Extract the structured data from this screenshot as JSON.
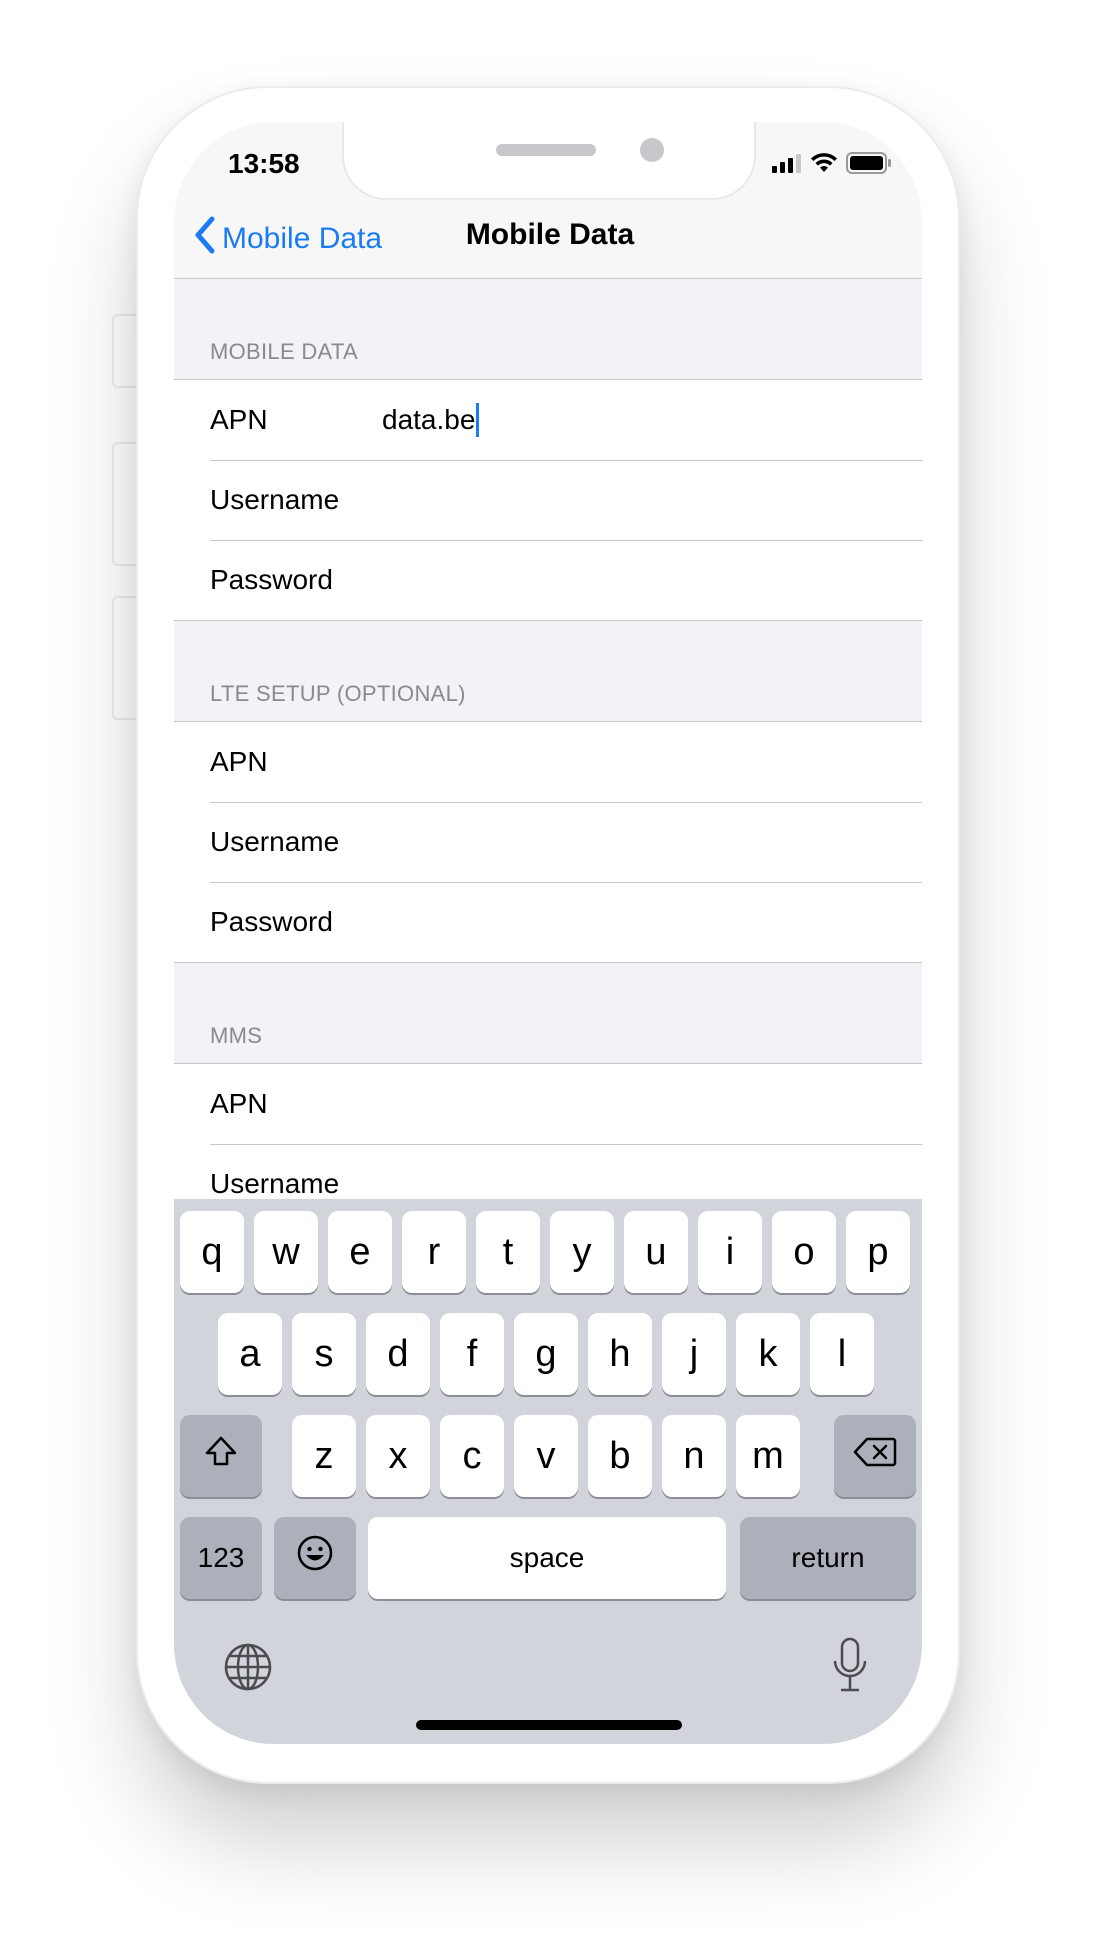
{
  "status_bar": {
    "time": "13:58",
    "icons": [
      "cellular-signal-icon",
      "wifi-icon",
      "battery-icon"
    ]
  },
  "nav": {
    "back_label": "Mobile Data",
    "title": "Mobile Data"
  },
  "sections": [
    {
      "header": "MOBILE DATA",
      "rows": [
        {
          "label": "APN",
          "value": "data.be",
          "focused": true
        },
        {
          "label": "Username",
          "value": ""
        },
        {
          "label": "Password",
          "value": ""
        }
      ]
    },
    {
      "header": "LTE SETUP (OPTIONAL)",
      "rows": [
        {
          "label": "APN",
          "value": ""
        },
        {
          "label": "Username",
          "value": ""
        },
        {
          "label": "Password",
          "value": ""
        }
      ]
    },
    {
      "header": "MMS",
      "rows": [
        {
          "label": "APN",
          "value": ""
        },
        {
          "label": "Username",
          "value": ""
        }
      ]
    }
  ],
  "keyboard": {
    "row1": [
      "q",
      "w",
      "e",
      "r",
      "t",
      "y",
      "u",
      "i",
      "o",
      "p"
    ],
    "row2": [
      "a",
      "s",
      "d",
      "f",
      "g",
      "h",
      "j",
      "k",
      "l"
    ],
    "row3": [
      "z",
      "x",
      "c",
      "v",
      "b",
      "n",
      "m"
    ],
    "numbers_label": "123",
    "space_label": "space",
    "return_label": "return",
    "icons": [
      "shift-icon",
      "backspace-icon",
      "emoji-icon",
      "globe-icon",
      "microphone-icon"
    ]
  },
  "colors": {
    "accent": "#1a7cf5",
    "grouped_background": "#f2f2f7",
    "keyboard_background": "#d1d4db",
    "key_dark": "#acb0ba"
  }
}
